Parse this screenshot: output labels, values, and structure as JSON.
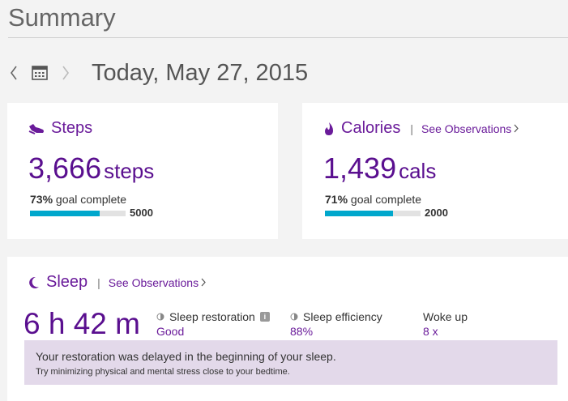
{
  "header": {
    "title": "Summary"
  },
  "date_nav": {
    "date": "Today, May 27, 2015"
  },
  "steps": {
    "title": "Steps",
    "value": "3,666",
    "unit": "steps",
    "goal_percent": "73%",
    "goal_text": "goal complete",
    "goal_fraction": 0.73,
    "goal_target": "5000"
  },
  "calories": {
    "title": "Calories",
    "separator": "|",
    "observations_link": "See Observations",
    "value": "1,439",
    "unit": "cals",
    "goal_percent": "71%",
    "goal_text": "goal complete",
    "goal_fraction": 0.71,
    "goal_target": "2000"
  },
  "sleep": {
    "title": "Sleep",
    "separator": "|",
    "observations_link": "See Observations",
    "duration": "6 h 42 m",
    "restoration_label": "Sleep restoration",
    "restoration_info": "i",
    "restoration_value": "Good",
    "efficiency_label": "Sleep efficiency",
    "efficiency_value": "88%",
    "wokeup_label": "Woke up",
    "wokeup_value": "8 x",
    "tip_main": "Your restoration was delayed in the beginning of your sleep.",
    "tip_sub": "Try minimizing physical and mental stress close to your bedtime."
  },
  "colors": {
    "accent_purple": "#5a0f8f",
    "progress_fill": "#00a7cc",
    "tip_background": "#e3d9ea"
  },
  "icons": [
    "chevron-left-icon",
    "calendar-icon",
    "chevron-right-icon",
    "shoe-icon",
    "flame-icon",
    "moon-icon",
    "chevron-right-small-icon",
    "half-moon-icon",
    "info-icon"
  ]
}
